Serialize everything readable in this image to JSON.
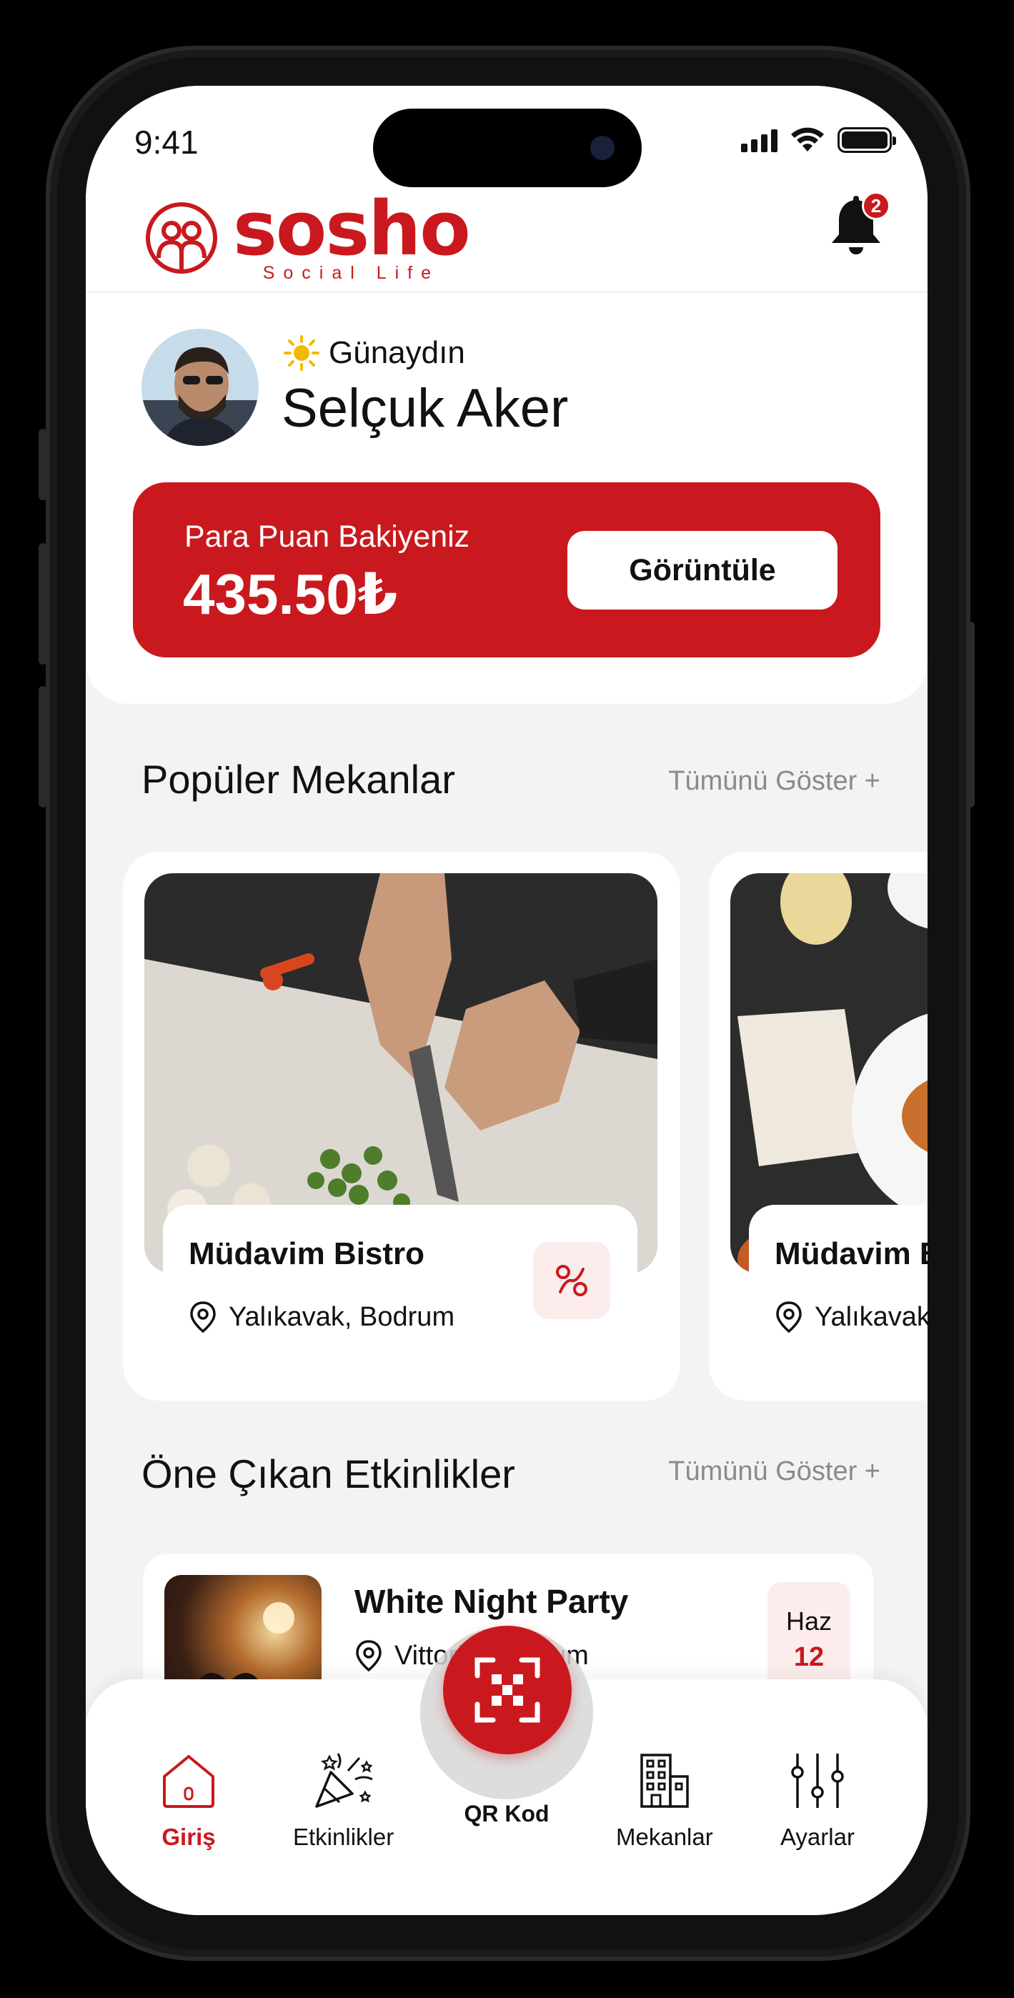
{
  "status": {
    "time": "9:41"
  },
  "brand": {
    "name": "sosho",
    "tagline": "Social Life"
  },
  "notifications": {
    "count": "2"
  },
  "user": {
    "greeting": "Günaydın",
    "name": "Selçuk Aker"
  },
  "balance": {
    "label": "Para Puan Bakiyeniz",
    "value": "435.50₺",
    "button": "Görüntüle"
  },
  "popular": {
    "title": "Popüler Mekanlar",
    "link": "Tümünü Göster +",
    "venues": [
      {
        "name": "Müdavim Bistro",
        "location": "Yalıkavak, Bodrum"
      },
      {
        "name": "Müdavim Bistro",
        "location": "Yalıkavak, Bodrum"
      }
    ]
  },
  "events": {
    "title": "Öne Çıkan Etkinlikler",
    "link": "Tümünü Göster +",
    "items": [
      {
        "title": "White Night Party",
        "location": "Vittoria, Bodrum",
        "month": "Haz",
        "day": "12"
      }
    ]
  },
  "tabbar": {
    "items": [
      {
        "label": "Giriş",
        "active": true
      },
      {
        "label": "Etkinlikler"
      },
      {
        "label": "QR Kod"
      },
      {
        "label": "Mekanlar"
      },
      {
        "label": "Ayarlar"
      }
    ]
  },
  "colors": {
    "brand": "#c9191e",
    "background": "#f3f3f3",
    "muted": "#8a8a8a"
  }
}
